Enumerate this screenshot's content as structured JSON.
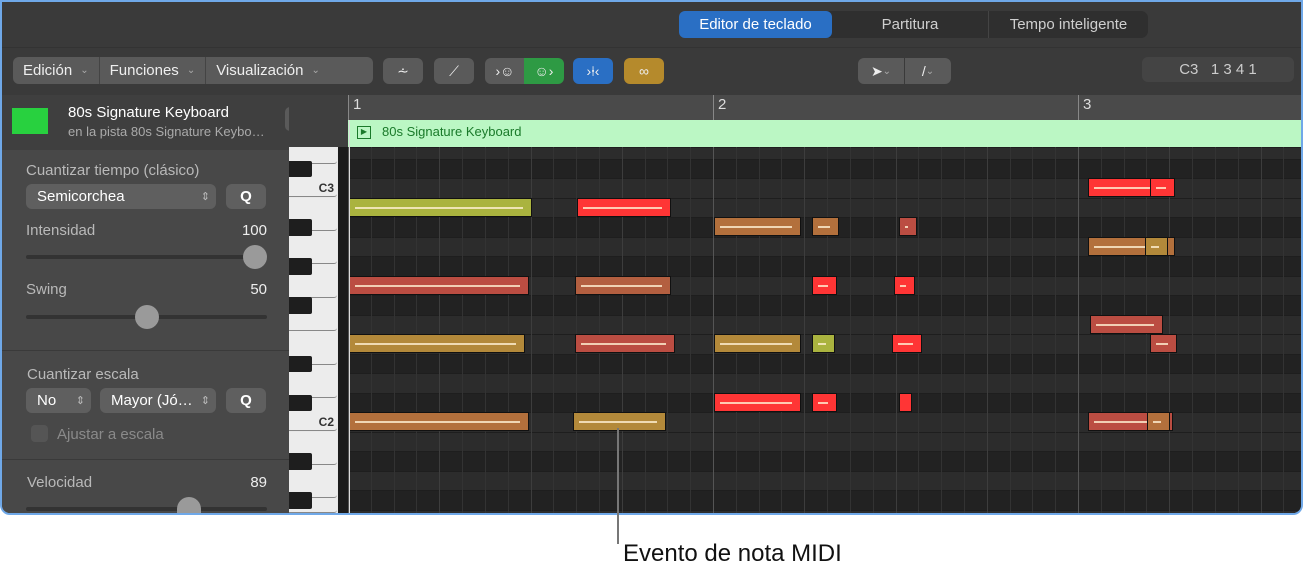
{
  "tabs": [
    {
      "label": "Editor de teclado",
      "active": true
    },
    {
      "label": "Partitura"
    },
    {
      "label": "Tempo inteligente"
    }
  ],
  "menus": [
    "Edición",
    "Funciones",
    "Visualización"
  ],
  "toolbar_icons": [
    "collapse-icon",
    "automation-icon",
    "midi-in-icon",
    "midi-out-icon",
    "catch-icon",
    "link-icon"
  ],
  "tools": {
    "pointer": "pointer-tool-icon",
    "pencil": "pencil-tool-icon"
  },
  "position_display": "C3   1 3 4 1",
  "region": {
    "name": "80s Signature Keyboard",
    "subtitle": "en la pista 80s Signature Keybo…"
  },
  "region_label": "80s Signature Keyboard",
  "ruler": [
    "1",
    "2",
    "3"
  ],
  "inspector": {
    "time_quantize_title": "Cuantizar tiempo (clásico)",
    "time_quantize_value": "Semicorchea",
    "q_label": "Q",
    "strength_label": "Intensidad",
    "strength_value": "100",
    "strength_fraction": 1.0,
    "swing_label": "Swing",
    "swing_value": "50",
    "swing_fraction": 0.5,
    "scale_quantize_title": "Cuantizar escala",
    "scale_root": "No",
    "scale_mode": "Mayor (Jó…",
    "snap_label": "Ajustar a escala",
    "velocity_label": "Velocidad",
    "velocity_value": "89",
    "velocity_fraction": 0.7
  },
  "key_labels": {
    "c3": "C3",
    "c2": "C2"
  },
  "colors": {
    "red": "#ff3535",
    "olive": "#aab33f",
    "brown": "#b3703c",
    "redbrown": "#bb4d42",
    "brownred": "#b35f40",
    "gold": "#b3893a"
  },
  "notes": [
    {
      "pitch": 0,
      "start": 32.4,
      "len": 3.3,
      "color": "red"
    },
    {
      "pitch": 0,
      "start": 35.1,
      "len": 1.1,
      "color": "red"
    },
    {
      "pitch": -1,
      "start": 0,
      "len": 8,
      "color": "olive"
    },
    {
      "pitch": -1,
      "start": 10,
      "len": 4.1,
      "color": "red"
    },
    {
      "pitch": -2,
      "start": 16,
      "len": 3.8,
      "color": "brown"
    },
    {
      "pitch": -2,
      "start": 20.3,
      "len": 1.2,
      "color": "brown"
    },
    {
      "pitch": -2,
      "start": 24.1,
      "len": 0.8,
      "color": "redbrown"
    },
    {
      "pitch": -3,
      "start": 32.4,
      "len": 3.8,
      "color": "brown"
    },
    {
      "pitch": -3,
      "start": 34.9,
      "len": 1.0,
      "color": "gold"
    },
    {
      "pitch": -5,
      "start": 0,
      "len": 7.9,
      "color": "redbrown"
    },
    {
      "pitch": -5,
      "start": 9.9,
      "len": 4.2,
      "color": "brownred"
    },
    {
      "pitch": -5,
      "start": 20.3,
      "len": 1.1,
      "color": "red"
    },
    {
      "pitch": -5,
      "start": 23.9,
      "len": 0.9,
      "color": "red"
    },
    {
      "pitch": -7,
      "start": 32.5,
      "len": 3.2,
      "color": "redbrown"
    },
    {
      "pitch": -8,
      "start": 0,
      "len": 7.7,
      "color": "gold"
    },
    {
      "pitch": -8,
      "start": 9.9,
      "len": 4.4,
      "color": "redbrown"
    },
    {
      "pitch": -8,
      "start": 16,
      "len": 3.8,
      "color": "gold"
    },
    {
      "pitch": -8,
      "start": 20.3,
      "len": 1.0,
      "color": "olive"
    },
    {
      "pitch": -8,
      "start": 23.8,
      "len": 1.3,
      "color": "red"
    },
    {
      "pitch": -8,
      "start": 35.1,
      "len": 1.2,
      "color": "redbrown"
    },
    {
      "pitch": -11,
      "start": 16,
      "len": 3.8,
      "color": "red"
    },
    {
      "pitch": -11,
      "start": 20.3,
      "len": 1.1,
      "color": "red"
    },
    {
      "pitch": -11,
      "start": 24.1,
      "len": 0.6,
      "color": "red"
    },
    {
      "pitch": -12,
      "start": 0,
      "len": 7.9,
      "color": "brown"
    },
    {
      "pitch": -12,
      "start": 9.8,
      "len": 4.1,
      "color": "gold"
    },
    {
      "pitch": -12,
      "start": 32.4,
      "len": 3.7,
      "color": "redbrown"
    },
    {
      "pitch": -12,
      "start": 35.0,
      "len": 1.0,
      "color": "brown"
    }
  ],
  "callout": "Evento de nota MIDI"
}
